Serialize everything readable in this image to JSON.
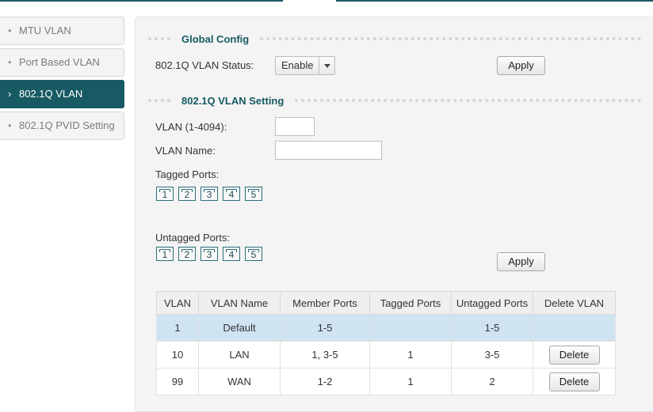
{
  "sidebar": {
    "items": [
      {
        "label": "MTU VLAN",
        "bullet": "•"
      },
      {
        "label": "Port Based VLAN",
        "bullet": "•"
      },
      {
        "label": "802.1Q VLAN",
        "bullet": "›"
      },
      {
        "label": "802.1Q PVID Setting",
        "bullet": "•"
      }
    ],
    "active_index": 2
  },
  "global_config": {
    "title": "Global Config",
    "status_label": "802.1Q VLAN Status:",
    "status_value": "Enable",
    "apply_label": "Apply"
  },
  "vlan_setting": {
    "title": "802.1Q VLAN Setting",
    "vlan_label": "VLAN (1-4094):",
    "vlan_value": "",
    "name_label": "VLAN Name:",
    "name_value": "",
    "tagged_label": "Tagged Ports:",
    "untagged_label": "Untagged Ports:",
    "ports": [
      "1",
      "2",
      "3",
      "4",
      "5"
    ],
    "apply_label": "Apply"
  },
  "table": {
    "headers": [
      "VLAN",
      "VLAN Name",
      "Member Ports",
      "Tagged Ports",
      "Untagged Ports",
      "Delete VLAN"
    ],
    "rows": [
      {
        "vlan": "1",
        "name": "Default",
        "member": "1-5",
        "tagged": "",
        "untagged": "1-5",
        "delete": ""
      },
      {
        "vlan": "10",
        "name": "LAN",
        "member": "1, 3-5",
        "tagged": "1",
        "untagged": "3-5",
        "delete": "Delete"
      },
      {
        "vlan": "99",
        "name": "WAN",
        "member": "1-2",
        "tagged": "1",
        "untagged": "2",
        "delete": "Delete"
      }
    ],
    "selected_row": 0
  },
  "colors": {
    "accent": "#175a63",
    "selected_row": "#cfe3f1"
  }
}
